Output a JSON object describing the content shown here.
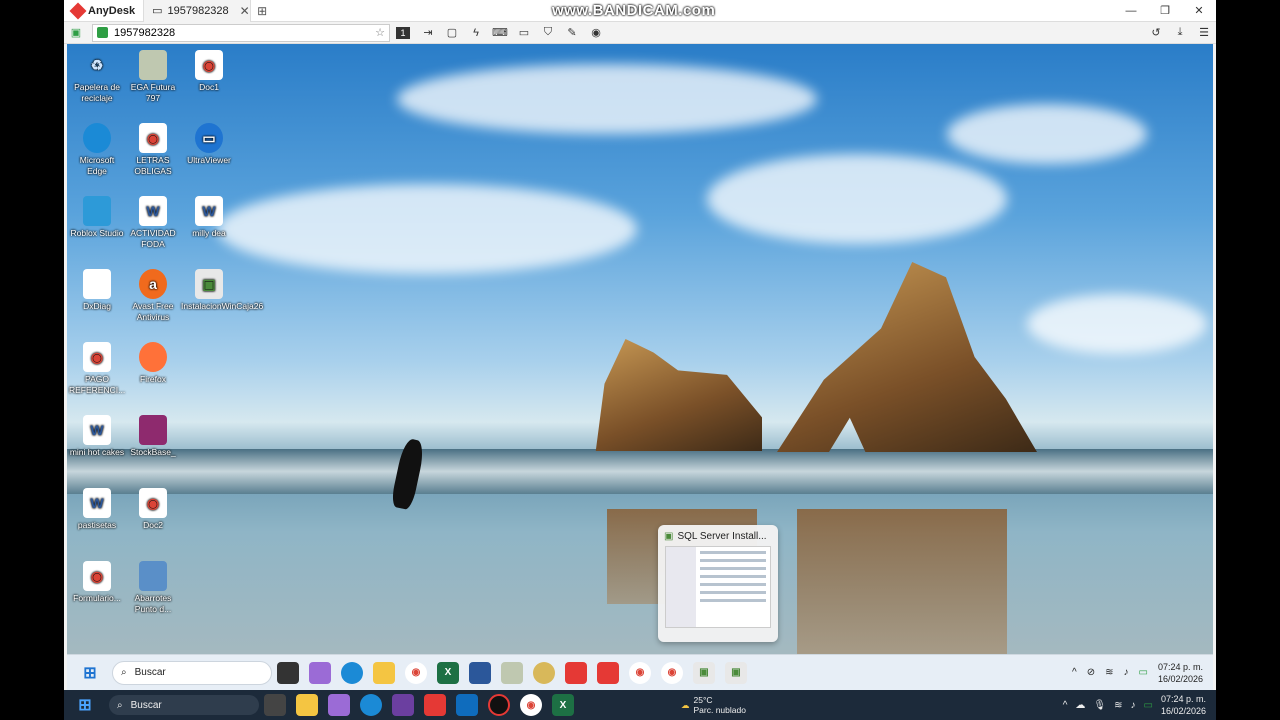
{
  "anydesk": {
    "brand": "AnyDesk",
    "tab_label": "1957982328",
    "address_value": "1957982328",
    "watermark": "www.BANDICAM.com",
    "monitor_index": "1"
  },
  "desktop_icons": [
    {
      "label": "Papelera de reciclaje",
      "icon": "recycle-bin-icon"
    },
    {
      "label": "EGA Futura 797",
      "icon": "app-icon"
    },
    {
      "label": "Doc1",
      "icon": "chrome-icon"
    },
    {
      "label": "Microsoft Edge",
      "icon": "edge-icon"
    },
    {
      "label": "LETRAS OBLIGAS",
      "icon": "chrome-icon"
    },
    {
      "label": "UltraViewer",
      "icon": "ultraviewer-icon"
    },
    {
      "label": "Roblox Studio",
      "icon": "roblox-icon"
    },
    {
      "label": "ACTIVIDAD FODA",
      "icon": "word-icon"
    },
    {
      "label": "milly dea",
      "icon": "word-icon"
    },
    {
      "label": "DxDiag",
      "icon": "document-icon"
    },
    {
      "label": "Avast Free Antivirus",
      "icon": "avast-icon"
    },
    {
      "label": "InstalacionWinCaja26",
      "icon": "installer-icon"
    },
    {
      "label": "PAGO REFERENCI...",
      "icon": "chrome-icon"
    },
    {
      "label": "Firefox",
      "icon": "firefox-icon"
    },
    {
      "label": "mini hot cakes",
      "icon": "word-icon"
    },
    {
      "label": "StockBase_",
      "icon": "winrar-icon"
    },
    {
      "label": "pastisetas",
      "icon": "word-icon"
    },
    {
      "label": "Doc2",
      "icon": "chrome-icon"
    },
    {
      "label": "Formulario...",
      "icon": "chrome-icon"
    },
    {
      "label": "Abarrotes Punto d...",
      "icon": "app-icon"
    }
  ],
  "thumbnail": {
    "title": "SQL Server Install..."
  },
  "remote_taskbar": {
    "search_placeholder": "Buscar",
    "time": "07:24 p. m.",
    "date": "16/02/2026"
  },
  "local_taskbar": {
    "search_placeholder": "Buscar",
    "temperature": "25°C",
    "weather": "Parc. nublado",
    "time": "07:24 p. m.",
    "date": "16/02/2026"
  },
  "colors": {
    "accent": "#e53935",
    "taskbar": "#1c2a3a"
  }
}
